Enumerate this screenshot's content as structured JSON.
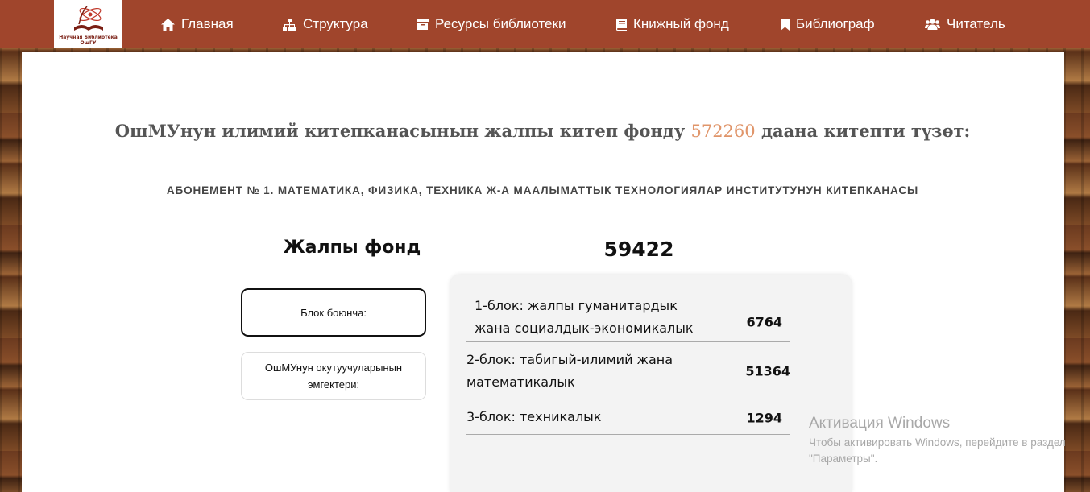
{
  "logo": {
    "caption": "Научная Библиотека ОшГУ"
  },
  "nav": {
    "items": [
      {
        "label": "Главная",
        "icon": "home-icon"
      },
      {
        "label": "Структура",
        "icon": "sitemap-icon"
      },
      {
        "label": "Ресурсы библиотеки",
        "icon": "archive-icon"
      },
      {
        "label": "Книжный фонд",
        "icon": "book-icon"
      },
      {
        "label": "Библиограф",
        "icon": "bookmark-icon"
      },
      {
        "label": "Читатель",
        "icon": "users-icon"
      }
    ]
  },
  "main": {
    "headline_before": "ОшМУнун илимий китепканасынын жалпы китеп фонду ",
    "headline_number": "572260",
    "headline_after": " даана китепти түзөт:",
    "subtitle": "АБОНЕМЕНТ № 1. МАТЕМАТИКА, ФИЗИКА, ТЕХНИКА Ж-А МААЛЫМАТТЫК ТЕХНОЛОГИЯЛАР ИНСТИТУТУНУН КИТЕПКАНАСЫ",
    "fond_label": "Жалпы фонд",
    "fond_total": "59422",
    "buttons": [
      {
        "label": "Блок боюнча:",
        "active": true
      },
      {
        "label": "ОшМУнун окутуучуларынын эмгектери:",
        "active": false
      }
    ],
    "table": [
      {
        "name": "1-блок: жалпы гуманитардык жана социалдык-экономикалык",
        "value": "6764"
      },
      {
        "name": "2-блок: табигый-илимий жана математикалык",
        "value": "51364"
      },
      {
        "name": "3-блок: техникалык",
        "value": "1294"
      }
    ]
  },
  "watermark": {
    "title": "Активация Windows",
    "text": "Чтобы активировать Windows, перейдите в раздел \"Параметры\"."
  },
  "colors": {
    "navbar": "#a0452c",
    "accent_number": "#e0956a",
    "divider": "#d9a58a"
  }
}
